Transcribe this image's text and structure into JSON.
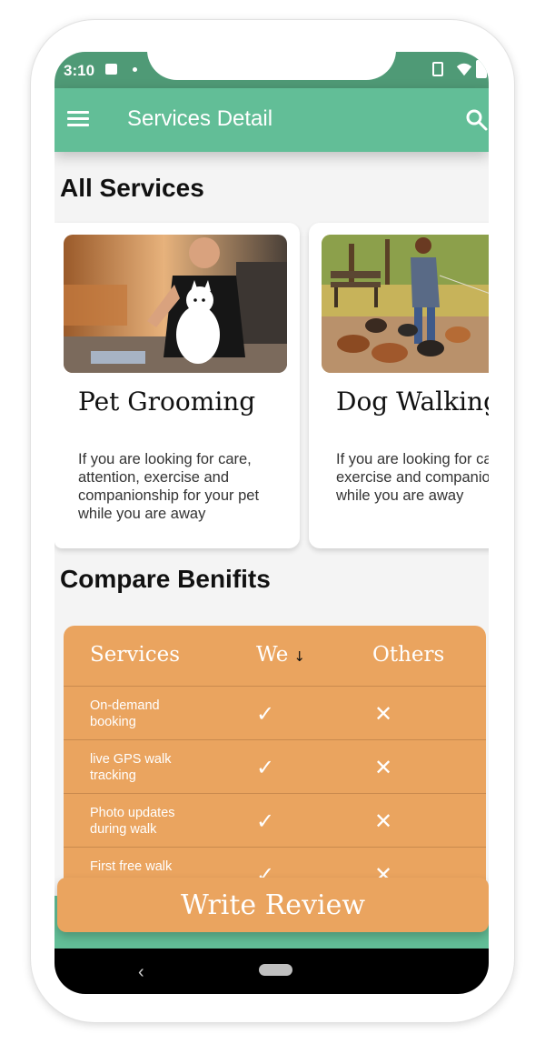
{
  "status_bar": {
    "time": "3:10",
    "icons": [
      "image-icon",
      "dot-icon",
      "vibrate-icon",
      "wifi-icon",
      "battery-icon"
    ]
  },
  "app_bar": {
    "title": "Services Detail",
    "left_icon": "menu-icon",
    "right_icon": "search-icon"
  },
  "all_services": {
    "title": "All Services",
    "cards": [
      {
        "title": "Pet Grooming",
        "description": "If you are looking for care, attention, exercise and companionship for your pet while you are away"
      },
      {
        "title": "Dog Walking",
        "description": "If you are looking for care, attention, exercise and companionship for your pet while you are away"
      }
    ]
  },
  "compare": {
    "title": "Compare Benifits",
    "headers": [
      "Services",
      "We",
      "Others"
    ],
    "sort_icon": "arrow-down-icon",
    "rows": [
      {
        "label": "On-demand booking",
        "we": "✓",
        "others": "✕"
      },
      {
        "label": "live GPS walk tracking",
        "we": "✓",
        "others": "✕"
      },
      {
        "label": "Photo updates during walk",
        "we": "✓",
        "others": "✕"
      },
      {
        "label": "First free walk",
        "we": "✓",
        "others": "✕"
      }
    ]
  },
  "write_review_button": "Write Review",
  "nav_bar": {
    "back_glyph": "‹"
  },
  "colors": {
    "primary_green": "#62be97",
    "status_green": "#4f9a76",
    "accent_orange": "#eaa45f"
  }
}
